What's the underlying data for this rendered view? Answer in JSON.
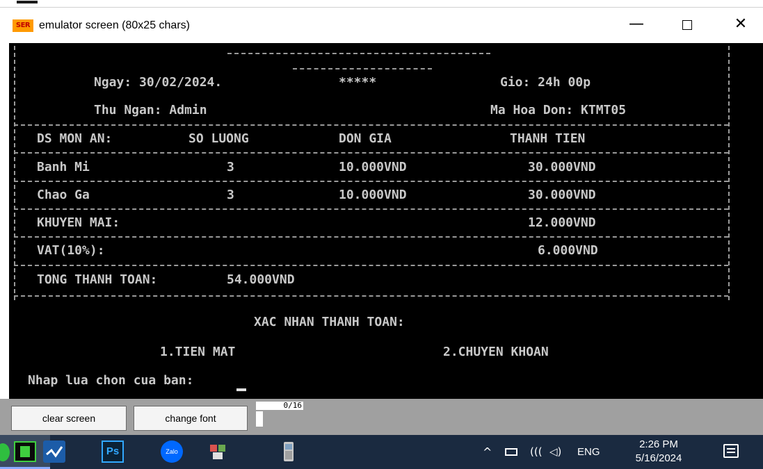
{
  "window": {
    "app_icon_text": "SER",
    "title": "emulator screen (80x25 chars)",
    "minimize_glyph": "—",
    "close_glyph": "✕"
  },
  "receipt": {
    "date": "Ngay: 30/02/2024.",
    "stars": "*****",
    "time": "Gio: 24h 00p",
    "cashier": "Thu Ngan: Admin",
    "invoice": "Ma Hoa Don: KTMT05",
    "headers": [
      "DS MON AN:",
      "SO LUONG",
      "DON GIA",
      "THANH TIEN"
    ],
    "items": [
      {
        "name": "Banh Mi",
        "qty": "3",
        "price": "10.000VND",
        "total": "30.000VND"
      },
      {
        "name": "Chao Ga",
        "qty": "3",
        "price": "10.000VND",
        "total": "30.000VND"
      }
    ],
    "discount_label": "KHUYEN MAI:",
    "discount_value": "12.000VND",
    "vat_label": "VAT(10%):",
    "vat_value": "6.000VND",
    "grand_total_label": "TONG THANH TOAN:",
    "grand_total_value": "54.000VND"
  },
  "payment": {
    "confirm": "XAC NHAN THANH TOAN:",
    "option1": "1.TIEN MAT",
    "option2": "2.CHUYEN KHOAN",
    "prompt": "Nhap lua chon cua ban:"
  },
  "buttons": {
    "clear": "clear screen",
    "font": "change font",
    "counter": "0/16"
  },
  "taskbar": {
    "apps": [
      "chart-app",
      "photoshop",
      "zalo",
      "people-app",
      "phone-app",
      "emulator-active"
    ],
    "ps_label": "Ps",
    "zalo_label": "Zalo",
    "tray_up": "^",
    "tray_wifi": "(((",
    "tray_volume": "◁)",
    "language": "ENG",
    "time": "2:26 PM",
    "date": "5/16/2024"
  },
  "colors": {
    "console_bg": "#000000",
    "console_text": "#c8c8c8",
    "taskbar_bg": "#1a2a40",
    "button_strip": "#a0a0a0"
  }
}
